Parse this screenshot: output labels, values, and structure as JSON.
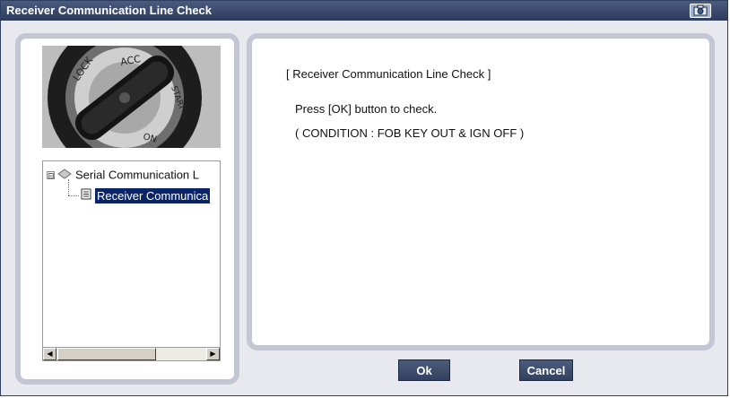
{
  "window": {
    "title": "Receiver Communication Line Check",
    "title_icon": "camera-icon"
  },
  "left_panel": {
    "image": {
      "name": "ignition-key-image",
      "labels": [
        "LOCK",
        "ACC",
        "START",
        "ON"
      ]
    },
    "tree": {
      "parent": {
        "label": "Serial Communication L",
        "icon": "diamond-node-icon",
        "expander": "⊟"
      },
      "child": {
        "label": "Receiver Communica",
        "icon": "document-icon",
        "selected": true
      }
    },
    "scrollbar": {
      "left_arrow": "◀",
      "right_arrow": "▶"
    }
  },
  "right_panel": {
    "title": "[ Receiver Communication Line Check ]",
    "line1": "Press [OK] button to check.",
    "line2": "( CONDITION : FOB KEY OUT & IGN OFF )"
  },
  "buttons": {
    "ok": "Ok",
    "cancel": "Cancel"
  },
  "colors": {
    "titlebar": "#2d3b5c",
    "panel_border": "#c3c6d3",
    "selection": "#0a246a",
    "button": "#3a4868"
  }
}
